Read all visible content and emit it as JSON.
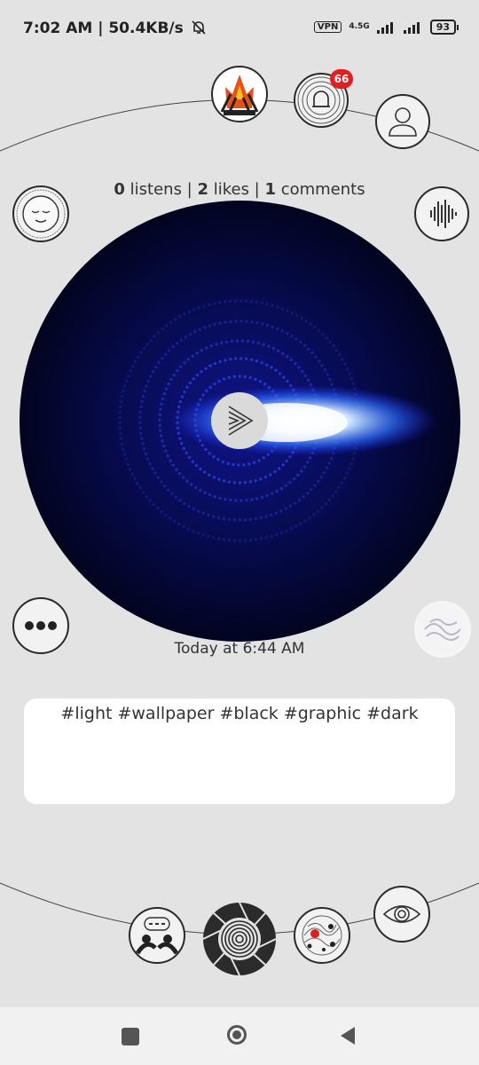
{
  "status_bar": {
    "time_speed": "7:02 AM | 50.4KB/s",
    "vpn": "VPN",
    "network": "4.5G",
    "battery": "93"
  },
  "notifications": {
    "count": "66"
  },
  "stats": {
    "listens_count": "0",
    "listens_label": " listens | ",
    "likes_count": "2",
    "likes_label": " likes | ",
    "comments_count": "1",
    "comments_label": " comments"
  },
  "post": {
    "timestamp": "Today at 6:44 AM",
    "tags": "#light #wallpaper #black #graphic #dark"
  }
}
